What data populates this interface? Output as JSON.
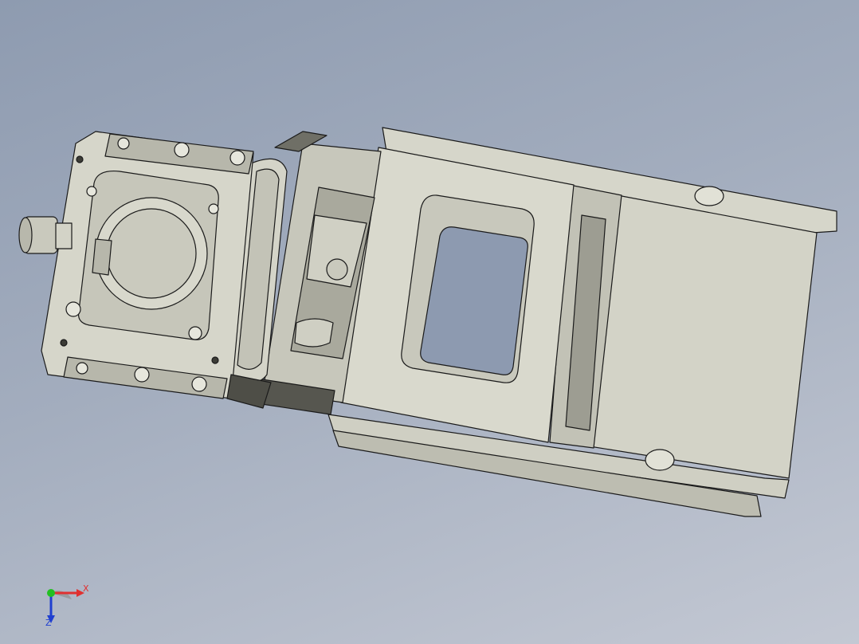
{
  "viewport": {
    "background_top": "#8e9bb0",
    "background_bottom": "#c3c8d3"
  },
  "model": {
    "part_color": "#d8d8cc",
    "shade_color": "#b5b5a8",
    "dark_color": "#6f6f66",
    "edge_color": "#1a1a1a"
  },
  "triad": {
    "x_label": "X",
    "z_label": "Z",
    "x_color": "#e03030",
    "y_color": "#22c022",
    "z_color": "#1f3fd0"
  }
}
